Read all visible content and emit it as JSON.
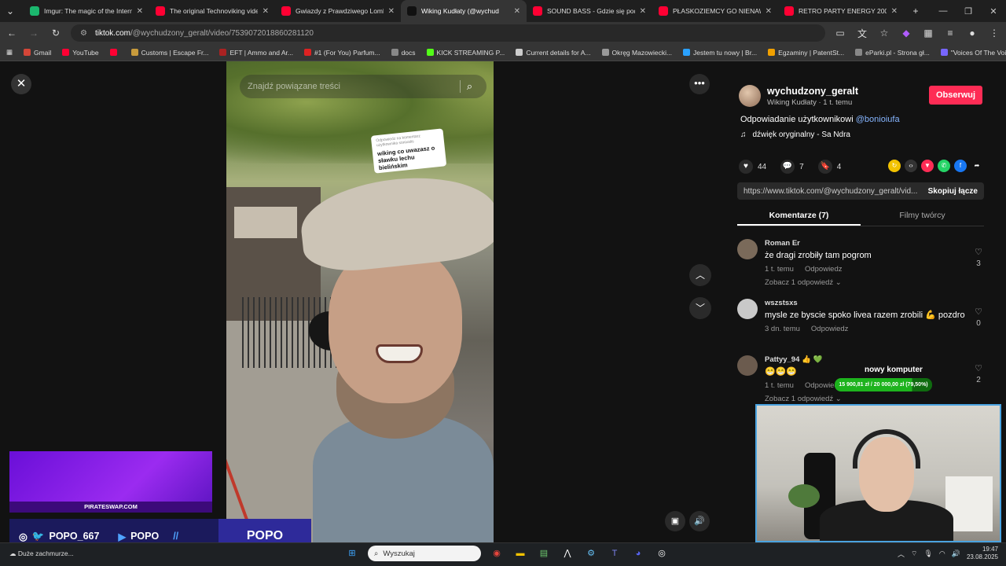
{
  "browser": {
    "tabs": [
      {
        "title": "Imgur: The magic of the Interne",
        "color": "#1bb76e"
      },
      {
        "title": "The original Technoviking vide",
        "color": "#ff0033"
      },
      {
        "title": "Gwiazdy z Prawdziwego Lomb",
        "color": "#ff0033"
      },
      {
        "title": "Wiking Kudłaty (@wychud",
        "color": "#111111"
      },
      {
        "title": "SOUND BASS - Gdzie się podzi",
        "color": "#ff0033"
      },
      {
        "title": "PŁASKOZIEMCY GO NIENAWID",
        "color": "#ff0033"
      },
      {
        "title": "RETRO PARTY ENERGY 2000 P",
        "color": "#ff0033"
      }
    ],
    "url_host": "tiktok.com",
    "url_path": "/@wychudzony_geralt/video/7539072018860281120",
    "bookmarks": [
      "Gmail",
      "YouTube",
      "",
      "Customs | Escape Fr...",
      "EFT | Ammo and Ar...",
      "#1 (For You) Parfum...",
      "docs",
      "KICK STREAMING P...",
      "Current details for A...",
      "Okręg Mazowiecki...",
      "Jestem tu nowy | Br...",
      "Egzaminy | PatentSt...",
      "eParki.pl - Strona gł...",
      "\"Voices Of The Void..."
    ]
  },
  "video": {
    "search_placeholder": "Znajdź powiązane treści",
    "sticker_header": "Odpowiedz na komentarz użytkownika sonixalis",
    "sticker_text": "wiking co uwazasz o sławku lechu bielińskim"
  },
  "post": {
    "username": "wychudzony_geralt",
    "subline": "Wiking Kudłaty · 1 t. temu",
    "follow_label": "Obserwuj",
    "desc_prefix": "Odpowiadanie użytkownikowi",
    "desc_mention": "@bonioiufa",
    "sound": "dźwięk oryginalny - Sa Ndra",
    "likes": "44",
    "comments": "7",
    "saves": "4",
    "link": "https://www.tiktok.com/@wychudzony_geralt/vid...",
    "copy_label": "Skopiuj łącze",
    "tab_comments": "Komentarze (7)",
    "tab_creator": "Filmy twórcy"
  },
  "comments": [
    {
      "user": "Roman Er",
      "text": "że dragi zrobiły tam pogrom",
      "time": "1 t. temu",
      "reply": "Odpowiedz",
      "replies": "Zobacz 1 odpowiedź ⌄",
      "likes": "3"
    },
    {
      "user": "wszstsxs",
      "text": "mysle ze byscie spoko livea razem zrobili 💪 pozdro",
      "time": "3 dn. temu",
      "reply": "Odpowiedz",
      "replies": "",
      "likes": "0"
    },
    {
      "user": "Pattyy_94 👍 💚",
      "text": "😁😁😁",
      "time": "1 t. temu",
      "reply": "Odpowiedz",
      "replies": "Zobacz 1 odpowiedź ⌄",
      "likes": "2"
    }
  ],
  "overlay": {
    "site": "PIRATESWAP.COM",
    "handle1": "POPO_667",
    "handle2": "POPO",
    "brand": "POPO",
    "donation_title": "nowy komputer",
    "donation_text": "15 900,81 zł / 20 000,00 zł (79,50%)",
    "donation_progress": 0.795
  },
  "taskbar": {
    "weather": "Duże zachmurze...",
    "search": "Wyszukaj",
    "time": "19:47",
    "date": "23.08.2025"
  }
}
